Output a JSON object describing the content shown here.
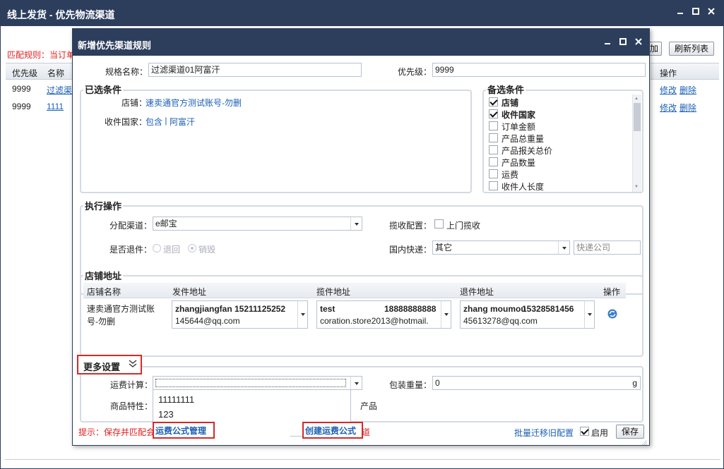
{
  "outer": {
    "title": "线上发货 - 优先物流渠道",
    "match_rule_text": "匹配规则：当订单",
    "buttons": {
      "partial": "加",
      "refresh": "刷新列表"
    },
    "grid": {
      "headers": {
        "priority": "优先级",
        "name": "名称",
        "ops": "操作"
      },
      "rows": [
        {
          "priority": "9999",
          "name": "过滤渠",
          "edit": "修改",
          "del": "删除"
        },
        {
          "priority": "9999",
          "name": "1111",
          "edit": "修改",
          "del": "删除"
        }
      ]
    }
  },
  "dialog": {
    "title": "新增优先渠道规则",
    "rule_name_label": "规格名称：",
    "rule_name_value": "过滤渠道01阿富汗",
    "priority_label": "优先级：",
    "priority_value": "9999",
    "selected": {
      "title": "已选条件",
      "shop_label": "店铺：",
      "shop_value": "速卖通官方测试账号-勿删",
      "country_label": "收件国家：",
      "country_include": "包含",
      "country_sep": " | ",
      "country_value": "阿富汗"
    },
    "candidates": {
      "title": "备选条件",
      "items": [
        {
          "label": "店铺",
          "checked": true
        },
        {
          "label": "收件国家",
          "checked": true
        },
        {
          "label": "订单金额",
          "checked": false
        },
        {
          "label": "产品总重量",
          "checked": false
        },
        {
          "label": "产品报关总价",
          "checked": false
        },
        {
          "label": "产品数量",
          "checked": false
        },
        {
          "label": "运费",
          "checked": false
        },
        {
          "label": "收件人长度",
          "checked": false
        }
      ]
    },
    "exec": {
      "title": "执行操作",
      "channel_label": "分配渠道：",
      "channel_value": "e邮宝",
      "pickup_label": "揽收配置：",
      "pickup_option": "上门揽收",
      "return_label": "是否退件：",
      "return_opt1": "退回",
      "return_opt2": "销毁",
      "domestic_label": "国内快递：",
      "domestic_value": "其它",
      "courier_placeholder": "快递公司"
    },
    "address": {
      "title": "店铺地址",
      "headers": {
        "shop": "店铺名称",
        "send": "发件地址",
        "pickup": "揽件地址",
        "return": "退件地址",
        "ops": "操作"
      },
      "row": {
        "shop": "速卖通官方测试账号-勿删",
        "send_name": "zhangjiangfan 15211125252",
        "send_email": "145644@qq.com",
        "pickup_name": "test",
        "pickup_phone": "18888888888",
        "pickup_email": "coration.store2013@hotmail.",
        "return_name": "zhang moumou",
        "return_phone": "15328581456",
        "return_email": "45613278@qq.com"
      }
    },
    "more": {
      "title": "更多设置",
      "freight_label": "运费计算：",
      "freight_options": [
        "11111111",
        "123"
      ],
      "weight_label": "包装重量：",
      "weight_value": "0",
      "weight_unit": "g",
      "product_label": "商品特性：",
      "product_tail": "产品",
      "freight_manage": "运费公式管理",
      "create_freight": "创建运费公式"
    },
    "footer": {
      "tip": "提示：保存并匹配会",
      "tip_tail": "道",
      "migrate": "批量迁移旧配置",
      "enable_label": "启用",
      "save": "保存"
    }
  }
}
